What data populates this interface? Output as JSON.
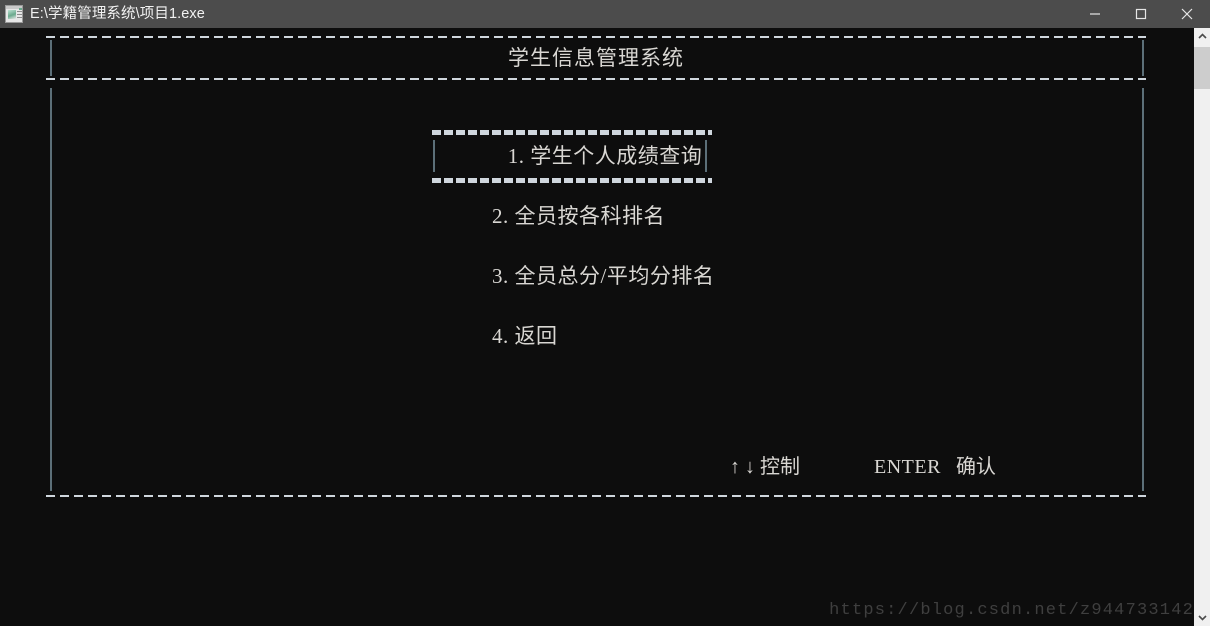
{
  "window": {
    "title": "E:\\学籍管理系统\\项目1.exe",
    "icon": "app-window-icon",
    "controls": {
      "minimize": "minimize-icon",
      "maximize": "maximize-icon",
      "close": "close-icon"
    }
  },
  "console": {
    "header_title": "学生信息管理系统",
    "menu": [
      {
        "label": "1. 学生个人成绩查询",
        "selected": true
      },
      {
        "label": "2. 全员按各科排名",
        "selected": false
      },
      {
        "label": "3. 全员总分/平均分排名",
        "selected": false
      },
      {
        "label": "4. 返回",
        "selected": false
      }
    ],
    "hints": {
      "keys": "↑ ↓ 控制",
      "enter_key": "ENTER",
      "enter_action": "确认"
    },
    "watermark": "https://blog.csdn.net/z944733142",
    "colors": {
      "background": "#0d0d0d",
      "text": "#d9d7d3",
      "border": "#cfd6dd",
      "accent_bar": "#5c6f78",
      "titlebar": "#4c4c4c"
    }
  },
  "scrollbar": {
    "up_arrow": "chevron-up-icon",
    "down_arrow": "chevron-down-icon",
    "thumb": "scroll-thumb"
  }
}
